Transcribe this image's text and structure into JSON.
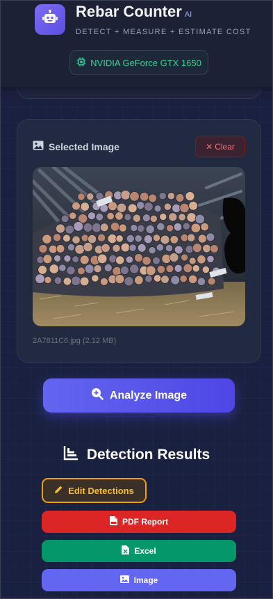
{
  "app": {
    "title": "Rebar Counter",
    "title_suffix": "AI",
    "tagline": "DETECT + MEASURE + ESTIMATE COST",
    "gpu_label": "NVIDIA GeForce GTX 1650"
  },
  "image_card": {
    "title": "Selected Image",
    "clear_label": "Clear",
    "file_name": "2A7811C6.jpg",
    "file_size": "(2.12 MB)"
  },
  "analyze": {
    "label": "Analyze Image"
  },
  "results": {
    "title": "Detection Results",
    "edit_label": "Edit Detections",
    "exports": [
      {
        "label": "PDF Report"
      },
      {
        "label": "Excel"
      },
      {
        "label": "Image"
      }
    ]
  },
  "colors": {
    "accent": "#6366f1",
    "gpu_green": "#34d399",
    "danger": "#dc2626",
    "success": "#059669",
    "warning": "#f59e0b"
  },
  "icons": [
    "robot-icon",
    "chip-icon",
    "image-icon",
    "close-icon",
    "search-plus-icon",
    "chart-icon",
    "pencil-icon",
    "pdf-file-icon",
    "excel-file-icon",
    "photo-icon"
  ]
}
